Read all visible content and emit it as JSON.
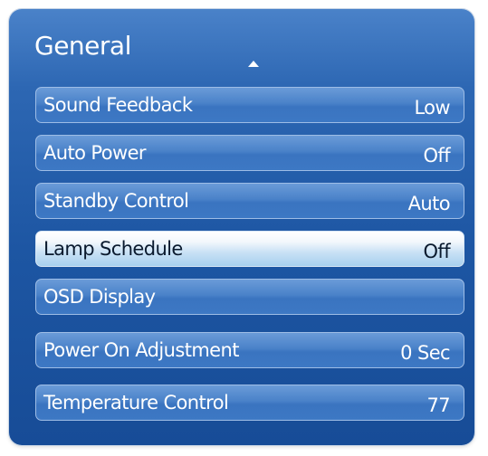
{
  "menu": {
    "title": "General",
    "scroll_up_icon": "up-arrow-icon",
    "items": [
      {
        "label": "Sound Feedback",
        "value": "Low"
      },
      {
        "label": "Auto Power",
        "value": "Off"
      },
      {
        "label": "Standby Control",
        "value": "Auto"
      },
      {
        "label": "Lamp Schedule",
        "value": "Off",
        "selected": true
      },
      {
        "label": "OSD Display",
        "value": ""
      },
      {
        "label": "Power On Adjustment",
        "value": "0 Sec"
      },
      {
        "label": "Temperature Control",
        "value": "77"
      }
    ]
  },
  "colors": {
    "panel_blue": "#1d56a3",
    "item_blue": "#4a82c9",
    "selected_highlight": "#c9e1f5"
  }
}
